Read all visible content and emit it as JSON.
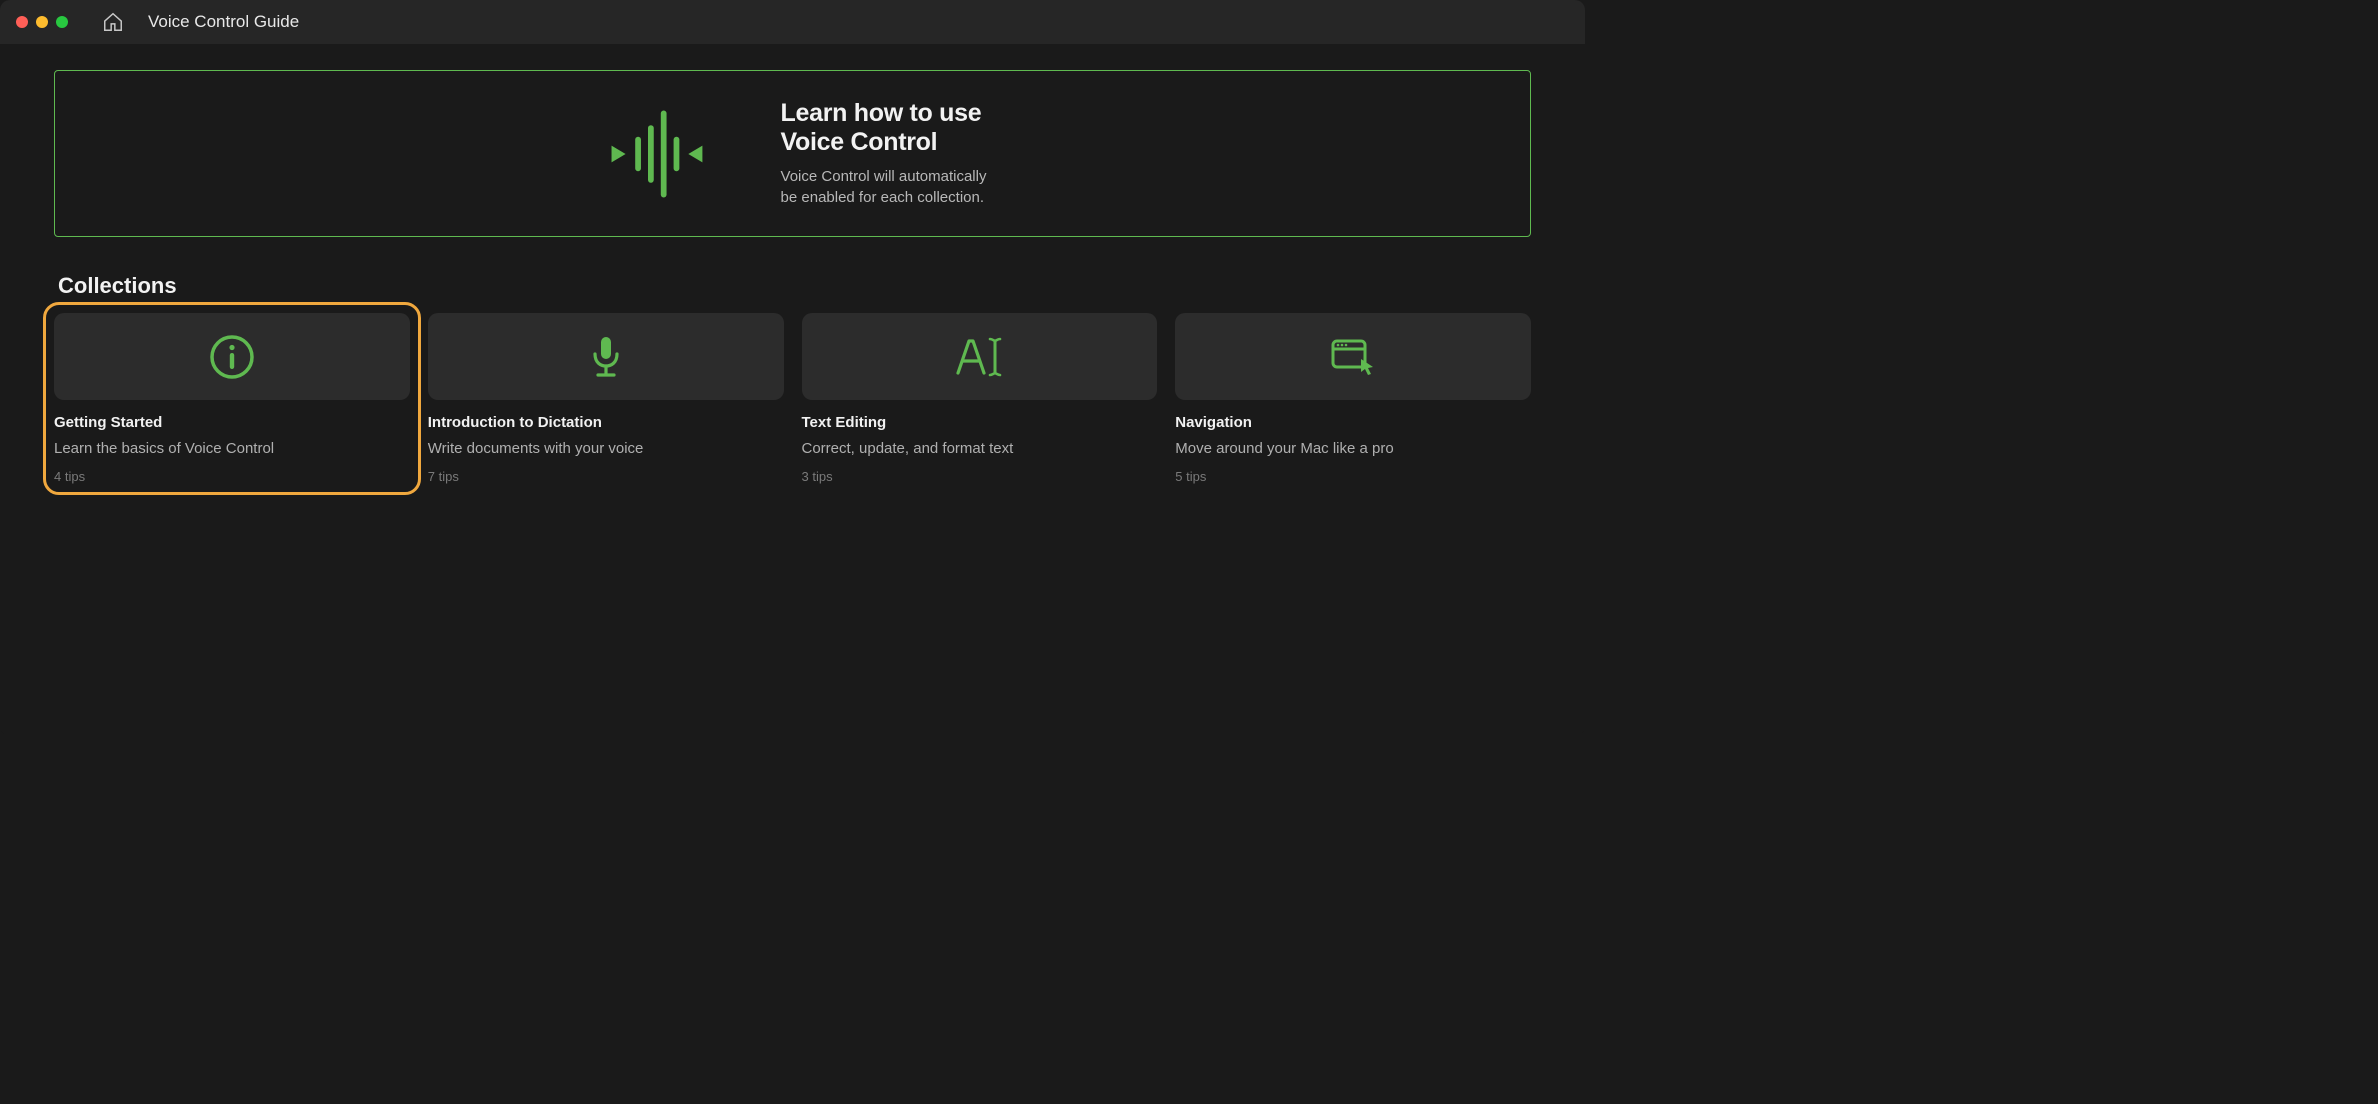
{
  "window": {
    "title": "Voice Control Guide"
  },
  "hero": {
    "title_line1": "Learn how to use",
    "title_line2": "Voice Control",
    "subtitle_line1": "Voice Control will automatically",
    "subtitle_line2": "be enabled for each collection."
  },
  "section": {
    "title": "Collections"
  },
  "cards": [
    {
      "icon": "info",
      "title": "Getting Started",
      "desc": "Learn the basics of Voice Control",
      "tips": "4 tips",
      "selected": true
    },
    {
      "icon": "mic",
      "title": "Introduction to Dictation",
      "desc": "Write documents with your voice",
      "tips": "7 tips",
      "selected": false
    },
    {
      "icon": "text-cursor",
      "title": "Text Editing",
      "desc": "Correct, update, and format text",
      "tips": "3 tips",
      "selected": false
    },
    {
      "icon": "window-pointer",
      "title": "Navigation",
      "desc": "Move around your Mac like a pro",
      "tips": "5 tips",
      "selected": false
    }
  ],
  "colors": {
    "accent": "#5fb950",
    "highlight": "#f0a83e"
  }
}
